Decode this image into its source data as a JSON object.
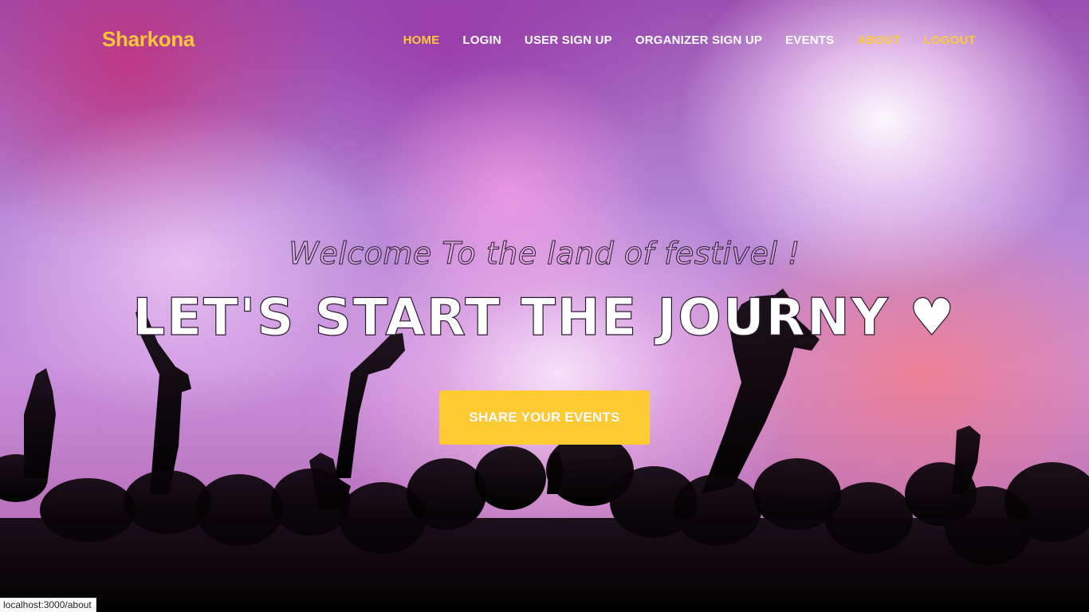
{
  "brand": {
    "name": "Sharkona"
  },
  "nav": {
    "home": "HOME",
    "login": "LOGIN",
    "user_signup": "USER SIGN UP",
    "organizer_signup": "ORGANIZER SIGN UP",
    "events": "EVENTS",
    "about": "ABOUT",
    "logout": "LOGOUT"
  },
  "hero": {
    "subtitle": "Welcome To the land of festivel !",
    "headline": "LET'S START THE JOURNY ♥",
    "cta_label": "SHARE YOUR EVENTS"
  },
  "status_bar": {
    "url": "localhost:3000/about"
  },
  "colors": {
    "accent": "#ffc83a",
    "button": "#fecb33",
    "nav_text": "#ffffff"
  }
}
